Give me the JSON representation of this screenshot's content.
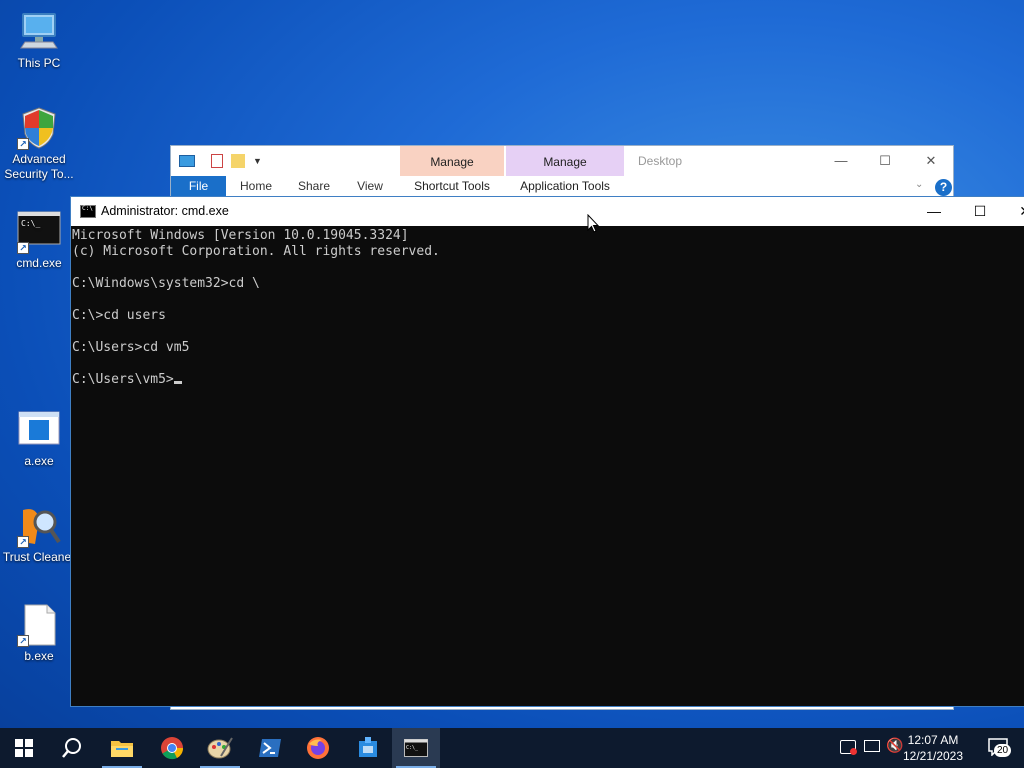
{
  "desktop": {
    "icons": [
      {
        "label": "This PC"
      },
      {
        "label": "Advanced Security To..."
      },
      {
        "label": "cmd.exe"
      },
      {
        "label": "a.exe"
      },
      {
        "label": "Trust Cleaner"
      },
      {
        "label": "b.exe"
      }
    ]
  },
  "explorer": {
    "title": "Desktop",
    "tabs": {
      "file": "File",
      "home": "Home",
      "share": "Share",
      "view": "View"
    },
    "context_tabs": [
      {
        "header": "Manage",
        "label": "Shortcut Tools",
        "color": "#f9d2c2"
      },
      {
        "header": "Manage",
        "label": "Application Tools",
        "color": "#e6d0f5"
      }
    ]
  },
  "cmd": {
    "title": "Administrator: cmd.exe",
    "lines": [
      "Microsoft Windows [Version 10.0.19045.3324]",
      "(c) Microsoft Corporation. All rights reserved.",
      "",
      "C:\\Windows\\system32>cd \\",
      "",
      "C:\\>cd users",
      "",
      "C:\\Users>cd vm5",
      "",
      "C:\\Users\\vm5>"
    ]
  },
  "taskbar": {
    "time": "12:07 AM",
    "date": "12/21/2023",
    "notification_count": "20"
  }
}
